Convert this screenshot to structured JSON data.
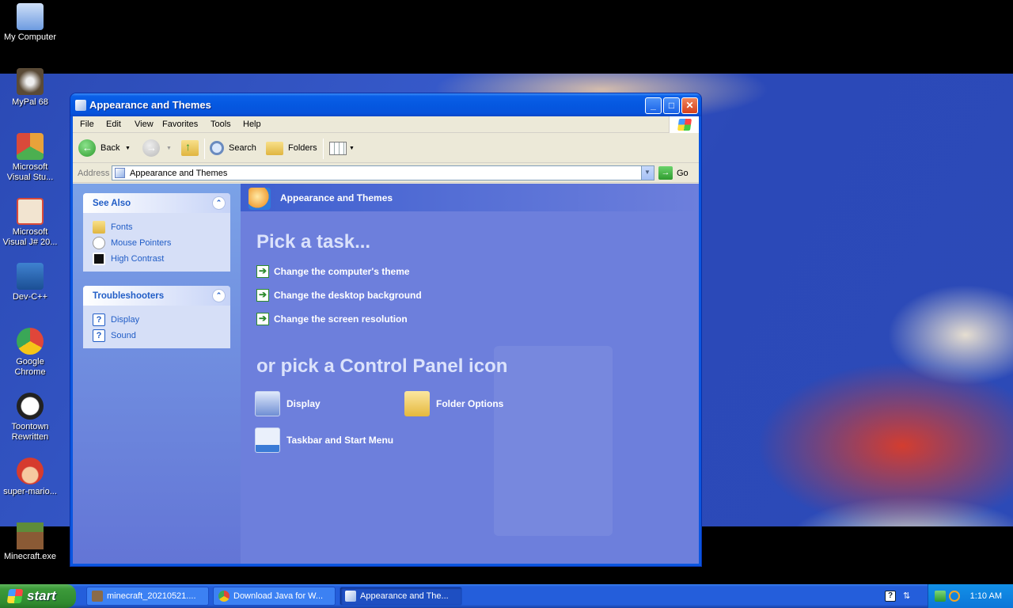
{
  "desktop": {
    "icons": [
      {
        "label": "My Computer",
        "icon": "my-computer-icon",
        "color": "#8fb4e8"
      },
      {
        "label": "MyPal 68",
        "icon": "mypal-icon",
        "color": "#5a4a36"
      },
      {
        "label": "Microsoft Visual Stu...",
        "icon": "visual-studio-icon",
        "color": "#e8a23a"
      },
      {
        "label": "Microsoft Visual J# 20...",
        "icon": "visual-jsharp-icon",
        "color": "#d94a3a"
      },
      {
        "label": "Dev-C++",
        "icon": "devcpp-icon",
        "color": "#2f6db5"
      },
      {
        "label": "Google Chrome",
        "icon": "chrome-icon",
        "color": "#e0463a"
      },
      {
        "label": "Toontown Rewritten",
        "icon": "toontown-icon",
        "color": "#f4f4f4"
      },
      {
        "label": "super-mario...",
        "icon": "mario-icon",
        "color": "#d63b2e"
      },
      {
        "label": "Minecraft.exe",
        "icon": "minecraft-icon",
        "color": "#5e8c3a"
      }
    ]
  },
  "window": {
    "title": "Appearance and Themes",
    "menu": [
      "File",
      "Edit",
      "View",
      "Favorites",
      "Tools",
      "Help"
    ],
    "toolbar": {
      "back": "Back",
      "search": "Search",
      "folders": "Folders"
    },
    "address": {
      "label": "Address",
      "value": "Appearance and Themes",
      "go": "Go"
    },
    "see_also": {
      "title": "See Also",
      "links": [
        {
          "label": "Fonts",
          "icon": "fonts-folder-icon"
        },
        {
          "label": "Mouse Pointers",
          "icon": "mouse-pointer-icon"
        },
        {
          "label": "High Contrast",
          "icon": "high-contrast-icon"
        }
      ]
    },
    "troubleshooters": {
      "title": "Troubleshooters",
      "links": [
        {
          "label": "Display",
          "icon": "help-icon"
        },
        {
          "label": "Sound",
          "icon": "help-icon"
        }
      ]
    },
    "main": {
      "header": "Appearance and Themes",
      "pick_task": "Pick a task...",
      "tasks": [
        "Change the computer's theme",
        "Change the desktop background",
        "Change the screen resolution"
      ],
      "pick_icon": "or pick a Control Panel icon",
      "icons": [
        {
          "label": "Display",
          "icon": "display-icon"
        },
        {
          "label": "Folder Options",
          "icon": "folder-options-icon"
        },
        {
          "label": "Taskbar and Start Menu",
          "icon": "taskbar-icon"
        }
      ]
    }
  },
  "taskbar": {
    "start": "start",
    "buttons": [
      {
        "label": "minecraft_20210521....",
        "active": false
      },
      {
        "label": "Download Java for W...",
        "active": false
      },
      {
        "label": "Appearance and The...",
        "active": true
      }
    ],
    "clock": "1:10 AM"
  }
}
